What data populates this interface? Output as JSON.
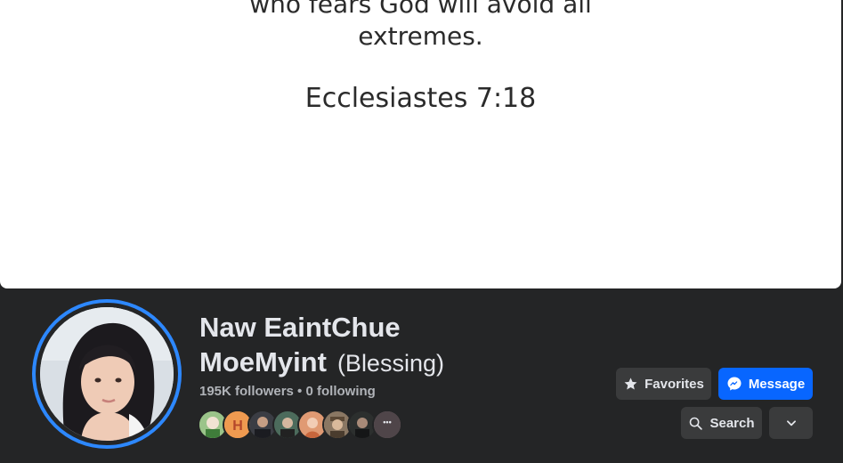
{
  "cover": {
    "quote_line1": "who fears God will avoid all",
    "quote_line2": "extremes.",
    "reference": "Ecclesiastes 7:18"
  },
  "profile": {
    "name_line1": "Naw EaintChue",
    "name_line2": "MoeMyint",
    "alternate_name": "(Blessing)",
    "followers": "195K followers",
    "separator": "•",
    "following": "0 following"
  },
  "friends": {
    "avatars": [
      "friend-avatar",
      "H",
      "friend-avatar",
      "friend-avatar",
      "friend-avatar",
      "friend-avatar",
      "friend-avatar",
      "more-icon"
    ],
    "more_label": "•••"
  },
  "actions": {
    "favorites_label": "Favorites",
    "message_label": "Message",
    "search_label": "Search"
  },
  "colors": {
    "background": "#242526",
    "accent_blue": "#0866ff",
    "ring_blue": "#2d88ff",
    "button_gray": "#3a3b3c"
  }
}
